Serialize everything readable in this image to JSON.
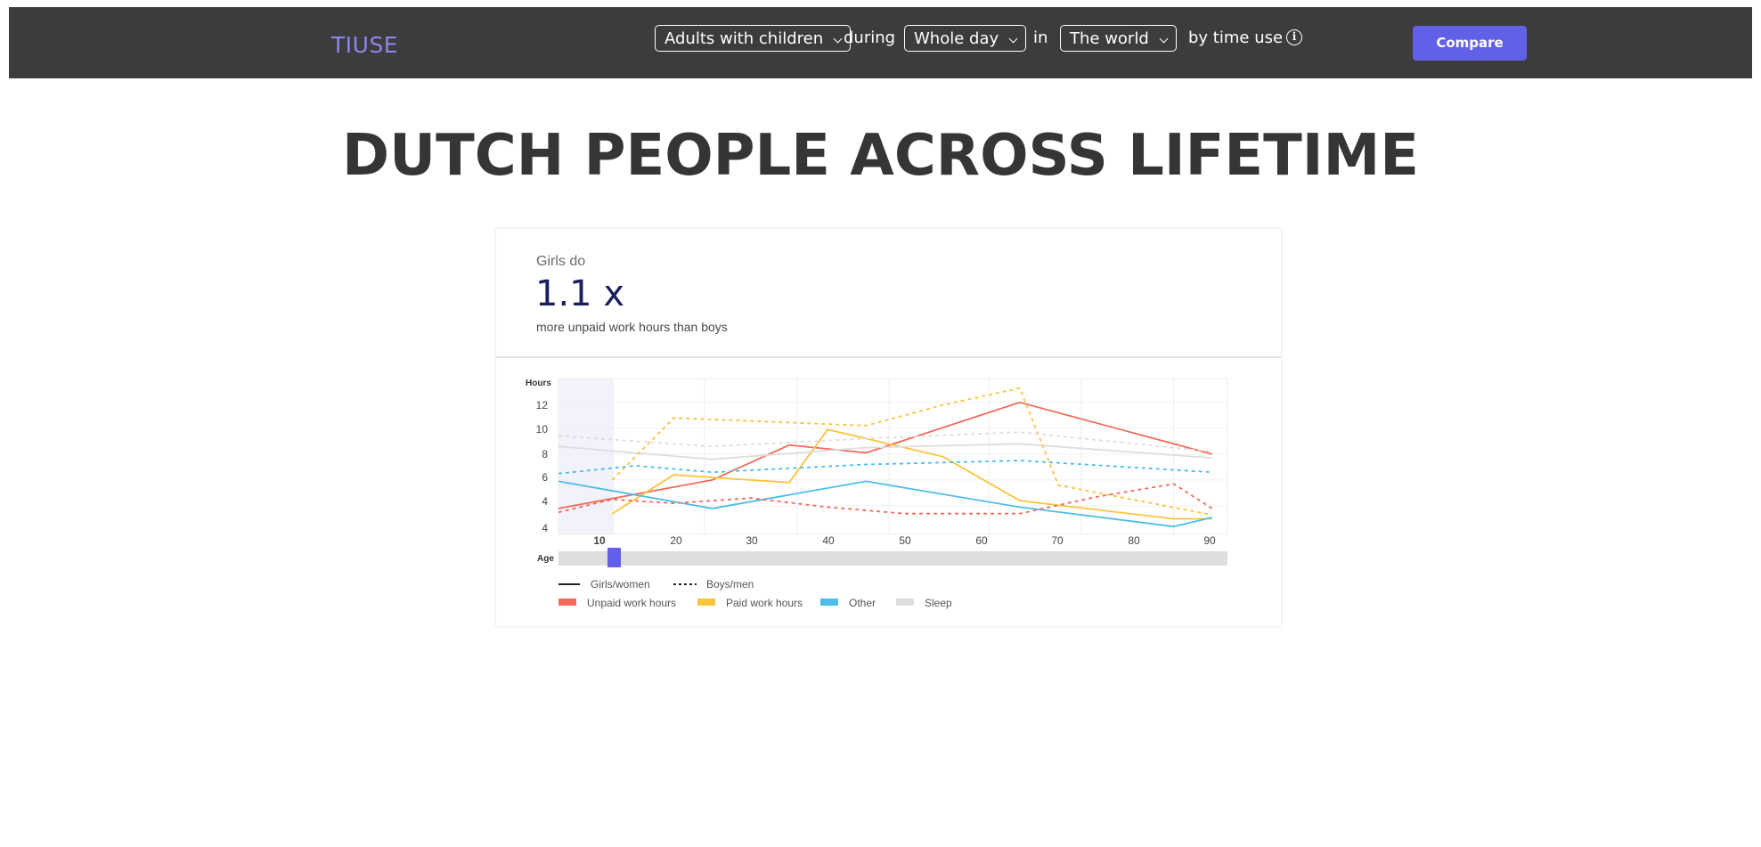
{
  "header": {
    "brand": "TIUSE",
    "group_select": "Adults with children",
    "conn_during": "during",
    "period_select": "Whole day",
    "conn_in": "in",
    "region_select": "The world",
    "conn_by": "by time use",
    "info_icon": "info-icon",
    "compare_label": "Compare"
  },
  "page": {
    "title": "DUTCH PEOPLE ACROSS LIFETIME"
  },
  "stat": {
    "kicker": "Girls do",
    "value": "1.1 x",
    "caption": "more unpaid work hours than boys"
  },
  "colors": {
    "accent": "#6360e8",
    "unpaid": "#f26b5b",
    "paid": "#fcc33d",
    "other": "#4cbde9",
    "sleep": "#dddddd"
  },
  "chart_data": {
    "type": "line",
    "ylabel": "Hours",
    "xlabel": "Age",
    "y_ticks": [
      "12",
      "10",
      "8",
      "6",
      "4",
      "4"
    ],
    "x_ticks": [
      "10",
      "20",
      "30",
      "40",
      "50",
      "60",
      "70",
      "80",
      "90"
    ],
    "selected_age": "10",
    "grid": true,
    "series": [
      {
        "name": "Unpaid work hours",
        "group": "Girls/women",
        "style": "solid",
        "color": "#f26b5b",
        "x": [
          5,
          25,
          35,
          45,
          65,
          90
        ],
        "y": [
          3.8,
          6.0,
          8.7,
          8.1,
          12.0,
          8.0
        ]
      },
      {
        "name": "Paid work hours",
        "group": "Girls/women",
        "style": "solid",
        "color": "#fcc33d",
        "x": [
          12,
          20,
          35,
          40,
          45,
          55,
          65,
          85,
          90
        ],
        "y": [
          3.4,
          6.4,
          5.8,
          9.9,
          9.2,
          7.8,
          4.4,
          3.0,
          3.0
        ]
      },
      {
        "name": "Other",
        "group": "Girls/women",
        "style": "solid",
        "color": "#4cbde9",
        "x": [
          5,
          25,
          45,
          65,
          85,
          90
        ],
        "y": [
          5.9,
          3.8,
          5.9,
          3.9,
          2.4,
          3.1
        ]
      },
      {
        "name": "Sleep",
        "group": "Girls/women",
        "style": "solid",
        "color": "#dddddd",
        "x": [
          5,
          25,
          45,
          65,
          90
        ],
        "y": [
          8.6,
          7.6,
          8.5,
          8.8,
          7.7
        ]
      },
      {
        "name": "Unpaid work hours",
        "group": "Boys/men",
        "style": "dashed",
        "color": "#f26b5b",
        "x": [
          5,
          12,
          20,
          30,
          40,
          50,
          65,
          75,
          85,
          90
        ],
        "y": [
          3.5,
          4.5,
          4.2,
          4.6,
          3.9,
          3.4,
          3.4,
          4.7,
          5.7,
          3.8
        ]
      },
      {
        "name": "Paid work hours",
        "group": "Boys/men",
        "style": "dashed",
        "color": "#fcc33d",
        "x": [
          12,
          20,
          45,
          55,
          65,
          70,
          90
        ],
        "y": [
          6.0,
          10.8,
          10.2,
          11.8,
          13.1,
          5.6,
          3.3
        ]
      },
      {
        "name": "Other",
        "group": "Boys/men",
        "style": "dashed",
        "color": "#4cbde9",
        "x": [
          5,
          15,
          25,
          45,
          65,
          90
        ],
        "y": [
          6.5,
          7.1,
          6.6,
          7.2,
          7.5,
          6.6
        ]
      },
      {
        "name": "Sleep",
        "group": "Boys/men",
        "style": "dashed",
        "color": "#dddddd",
        "x": [
          5,
          25,
          45,
          65,
          90
        ],
        "y": [
          9.4,
          8.6,
          9.2,
          9.7,
          8.2
        ]
      }
    ],
    "legend": {
      "line_styles": [
        "Girls/women",
        "Boys/men"
      ],
      "categories": [
        "Unpaid work hours",
        "Paid work hours",
        "Other",
        "Sleep"
      ]
    }
  }
}
